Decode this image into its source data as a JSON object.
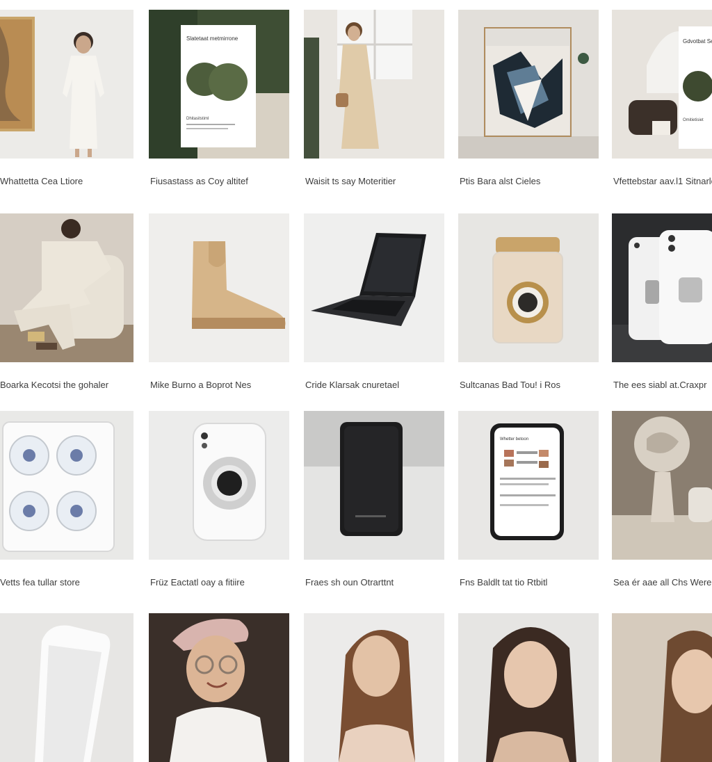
{
  "products": [
    {
      "caption": "Whattetta Cea Ltiore",
      "image": "woman-white-dress"
    },
    {
      "caption": "Fiusastass as Coy altitef",
      "image": "book-green-stones"
    },
    {
      "caption": "Waisit ts say Moteritier",
      "image": "woman-beige-coat"
    },
    {
      "caption": "Ptis Bara alst Cieles",
      "image": "abstract-canvas"
    },
    {
      "caption": "Vfettebstar aav.l1 Sitnarle",
      "image": "interior-book"
    },
    {
      "caption": "Boarka Kecotsi the gohaler",
      "image": "man-armchair"
    },
    {
      "caption": "Mike Burno a Boprot Nes",
      "image": "tan-chelsea-boot"
    },
    {
      "caption": "Cride Klarsak cnuretael",
      "image": "black-laptop"
    },
    {
      "caption": "Sultcanas Bad Tou! i Ros",
      "image": "glass-jar"
    },
    {
      "caption": "The ees siabl at.Craxpr",
      "image": "white-phone-cases"
    },
    {
      "caption": "Vetts fea tullar store",
      "image": "white-speaker-unit"
    },
    {
      "caption": "Früz Eactatl oay a fitiire",
      "image": "white-camera-device"
    },
    {
      "caption": "Fraes sh oun Otrarttnt",
      "image": "black-power-bank"
    },
    {
      "caption": "Fns Baldlt tat tio Rtbitl",
      "image": "smartphone-app"
    },
    {
      "caption": "Sea ér aae all Chs Were",
      "image": "sculpture-lamp"
    },
    {
      "caption": "",
      "image": "white-tablet"
    },
    {
      "caption": "",
      "image": "smiling-woman-glasses"
    },
    {
      "caption": "",
      "image": "woman-portrait-1"
    },
    {
      "caption": "",
      "image": "woman-portrait-2"
    },
    {
      "caption": "",
      "image": "woman-portrait-3"
    }
  ],
  "thumb_text": {
    "book_title": "Slatetaat metmirrone",
    "book_sub": "Dhitasitstiml",
    "interior_book_title": "Gdvotbat Sethumoren",
    "interior_book_sub": "Omitietisiet",
    "app_header": "Whetter betoon"
  }
}
